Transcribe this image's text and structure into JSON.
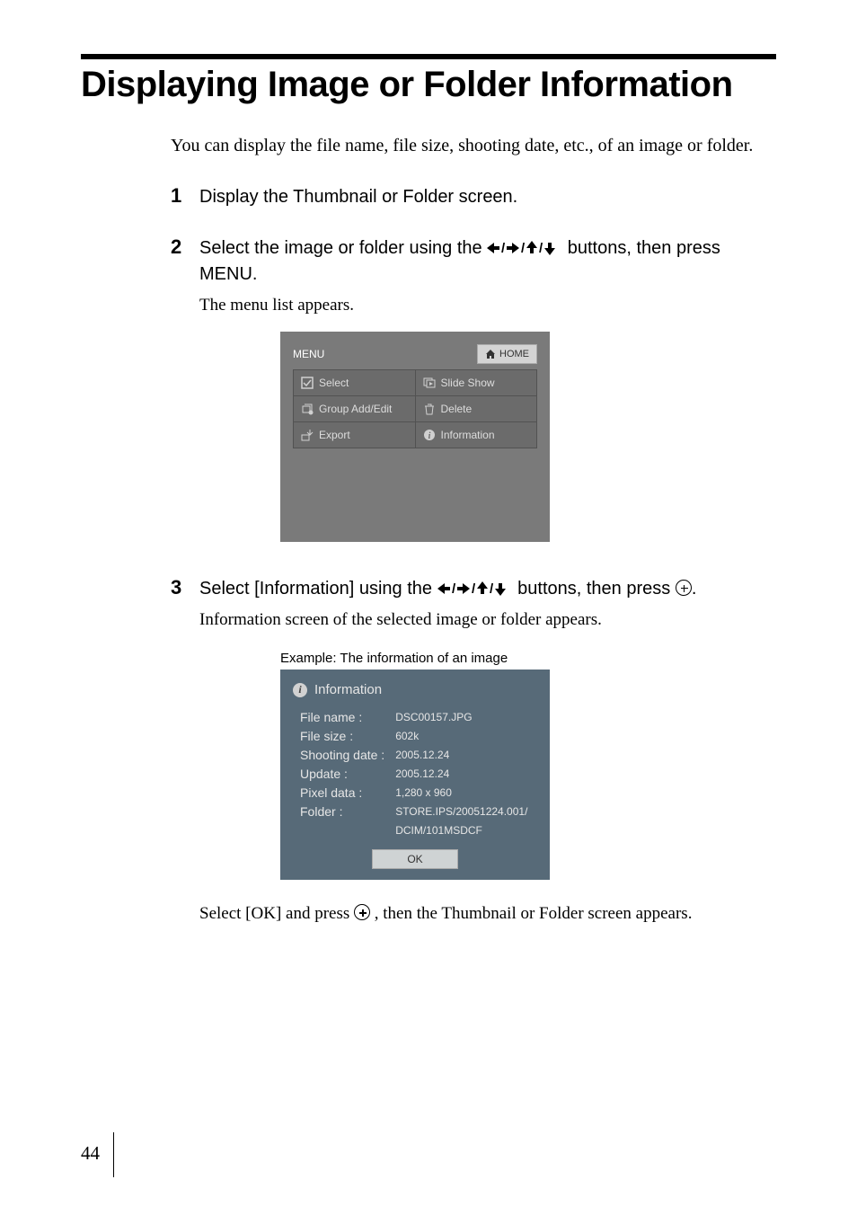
{
  "title": "Displaying Image or Folder Information",
  "intro": "You can display the file name, file size, shooting date, etc., of an image or folder.",
  "steps": {
    "s1": {
      "num": "1",
      "main": "Display the Thumbnail or Folder screen."
    },
    "s2": {
      "num": "2",
      "main_a": "Select the image or folder using the ",
      "main_b": " buttons, then press MENU.",
      "sub": "The menu list appears."
    },
    "s3": {
      "num": "3",
      "main_a": "Select [Information] using the ",
      "main_b": " buttons, then press ",
      "sub": "Information screen of the selected image or folder appears.",
      "after": "Select [OK] and press ",
      "after_b": ", then the Thumbnail or Folder screen appears."
    }
  },
  "menu": {
    "title": "MENU",
    "home": "HOME",
    "items": {
      "select": "Select",
      "slideshow": "Slide Show",
      "group": "Group Add/Edit",
      "delete": "Delete",
      "export": "Export",
      "info": "Information"
    }
  },
  "example_caption": "Example: The information of an image",
  "info": {
    "header": "Information",
    "labels": {
      "filename": "File name :",
      "filesize": "File size :",
      "shooting": "Shooting date :",
      "update": "Update :",
      "pixel": "Pixel data :",
      "folder": "Folder :"
    },
    "values": {
      "filename": "DSC00157.JPG",
      "filesize": "602k",
      "shooting": "2005.12.24",
      "update": "2005.12.24",
      "pixel": "1,280 x 960",
      "folder1": "STORE.IPS/20051224.001/",
      "folder2": "DCIM/101MSDCF"
    },
    "ok": "OK"
  },
  "page_number": "44"
}
